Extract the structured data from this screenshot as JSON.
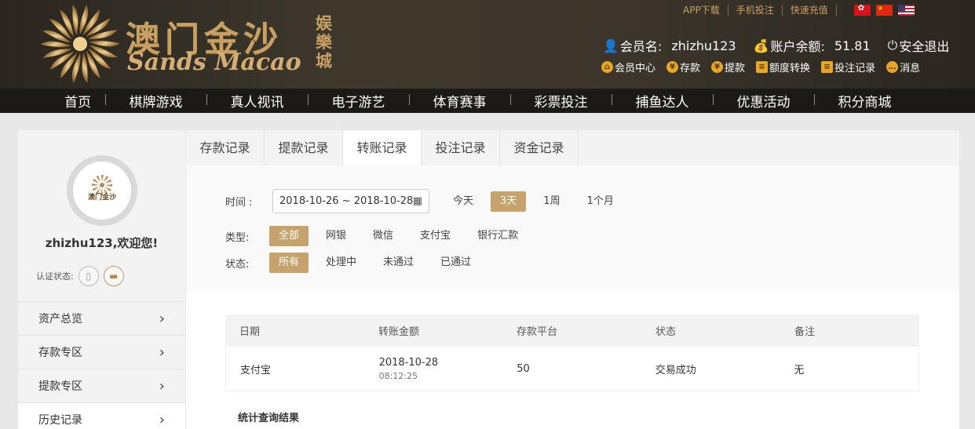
{
  "header": {
    "logo_cn": "澳门金沙",
    "logo_en": "Sands Macao",
    "logo_yule": "娱樂城",
    "top_links": [
      "APP下载",
      "手机投注",
      "快速充值"
    ],
    "user": {
      "member_label": "会员名:",
      "member_name": "zhizhu123",
      "balance_label": "账户余额:",
      "balance_value": "51.81",
      "logout": "安全退出"
    },
    "member_links": [
      "会员中心",
      "存款",
      "提款",
      "额度转换",
      "投注记录",
      "消息"
    ]
  },
  "nav": [
    "首页",
    "棋牌游戏",
    "真人视讯",
    "电子游艺",
    "体育赛事",
    "彩票投注",
    "捕鱼达人",
    "优惠活动",
    "积分商城"
  ],
  "sidebar": {
    "welcome": "zhizhu123,欢迎您!",
    "verify_label": "认证状态:",
    "menu": [
      "资产总览",
      "存款专区",
      "提款专区",
      "历史记录"
    ]
  },
  "tabs": [
    "存款记录",
    "提款记录",
    "转账记录",
    "投注记录",
    "资金记录"
  ],
  "filters": {
    "time_label": "时间 :",
    "date_range": "2018-10-26 ~ 2018-10-28",
    "time_options": [
      "今天",
      "3天",
      "1周",
      "1个月"
    ],
    "type_label": "类型:",
    "type_options": [
      "全部",
      "网银",
      "微信",
      "支付宝",
      "银行汇款"
    ],
    "status_label": "状态:",
    "status_options": [
      "所有",
      "处理中",
      "未通过",
      "已通过"
    ]
  },
  "table": {
    "headers": [
      "日期",
      "转账金额",
      "存款平台",
      "状态",
      "备注"
    ],
    "rows": [
      {
        "c1": "支付宝",
        "date": "2018-10-28",
        "time": "08:12:25",
        "platform": "50",
        "status": "交易成功",
        "note": "无"
      }
    ]
  },
  "stats_title": "统计查询结果"
}
